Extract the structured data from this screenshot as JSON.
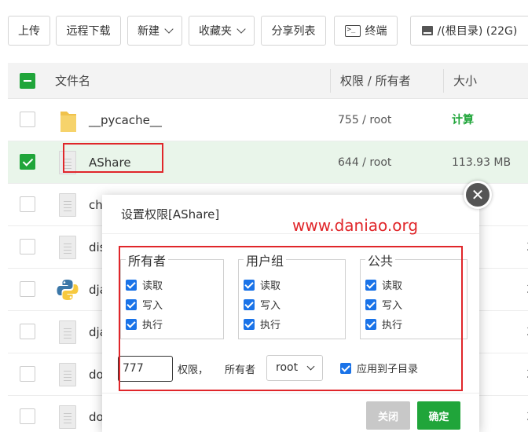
{
  "toolbar": {
    "upload": "上传",
    "remote_download": "远程下载",
    "new": "新建",
    "favorites": "收藏夹",
    "share_list": "分享列表",
    "terminal": "终端",
    "disk": "/(根目录) (22G)"
  },
  "table": {
    "headers": {
      "name": "文件名",
      "perm": "权限 / 所有者",
      "size": "大小"
    },
    "rows": [
      {
        "name": "__pycache__",
        "perm": "755 / root",
        "size": "计算",
        "type": "folder"
      },
      {
        "name": "AShare",
        "perm": "644 / root",
        "size": "113.93 MB",
        "type": "doc"
      },
      {
        "name": "ch",
        "perm": "",
        "size": "",
        "type": "doc"
      },
      {
        "name": "dis",
        "perm": "",
        "size": "",
        "type": "doc"
      },
      {
        "name": "dja",
        "perm": "",
        "size": "",
        "type": "python"
      },
      {
        "name": "dja",
        "perm": "",
        "size": "",
        "type": "doc"
      },
      {
        "name": "do",
        "perm": "",
        "size": "",
        "type": "doc"
      },
      {
        "name": "do",
        "perm": "",
        "size": "",
        "type": "doc"
      }
    ],
    "right_fragments": [
      "3",
      "3",
      "3",
      "3",
      "3",
      "3"
    ]
  },
  "dialog": {
    "title": "设置权限[AShare]",
    "watermark": "www.daniao.org",
    "groups": [
      {
        "legend": "所有者",
        "perms": [
          "读取",
          "写入",
          "执行"
        ]
      },
      {
        "legend": "用户组",
        "perms": [
          "读取",
          "写入",
          "执行"
        ]
      },
      {
        "legend": "公共",
        "perms": [
          "读取",
          "写入",
          "执行"
        ]
      }
    ],
    "mode_value": "777",
    "perm_label": "权限，",
    "owner_label": "所有者",
    "owner_value": "root",
    "apply_sub": "应用到子目录",
    "close_label": "关闭",
    "confirm_label": "确定"
  },
  "colors": {
    "accent": "#20a53a",
    "highlight": "#e0262a",
    "checkbox": "#1a73e8"
  }
}
